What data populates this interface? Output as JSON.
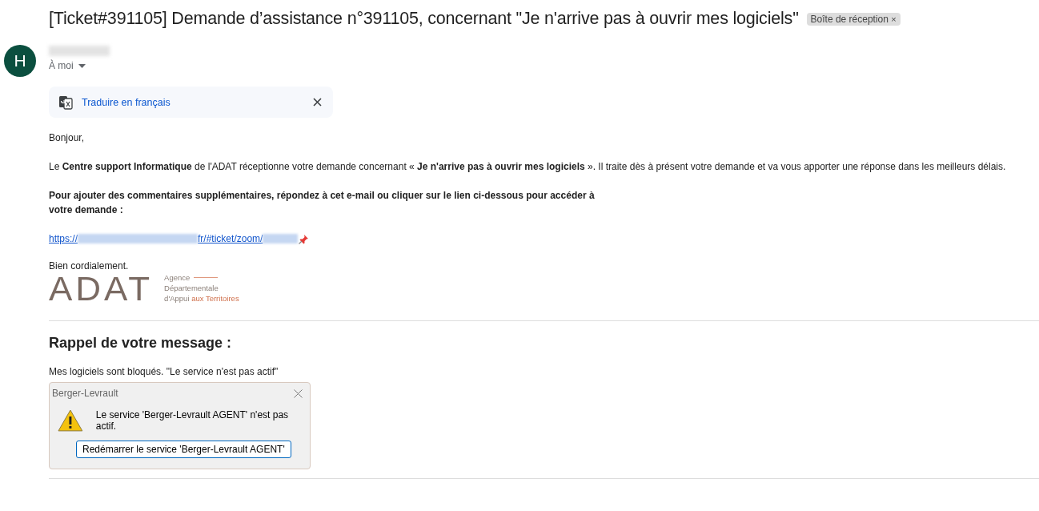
{
  "subject": "[Ticket#391105] Demande d’assistance n°391105, concernant \"Je n'arrive pas à ouvrir mes logiciels\"",
  "label": {
    "text": "Boîte de réception",
    "remove": "×"
  },
  "sender": {
    "avatar": "H",
    "recipient": "À moi"
  },
  "translate": {
    "label": "Traduire en français"
  },
  "body": {
    "greeting": "Bonjour,",
    "paragraph": "Le  **Centre support Informatique** de l'ADAT réceptionne votre demande concernant «  **Je n'arrive pas à ouvrir mes logiciels** ». Il traite dès à présent votre demande et va vous apporter une réponse dans les meilleurs délais.",
    "instruction_lines": [
      "Pour ajouter des commentaires supplémentaires, répondez à cet e-mail ou cliquer sur le lien ci-dessous pour accéder à",
      "votre demande :"
    ],
    "link": {
      "prefix": "https://",
      "middle": "fr/#ticket/zoom/"
    },
    "closing": "Bien cordialement.",
    "logo": {
      "mark": "ADAT",
      "lines": [
        "Agence",
        "Départementale"
      ],
      "line3": "d'Appui",
      "line3_accent": "aux Territoires"
    }
  },
  "reminder": {
    "heading": "Rappel de votre message :",
    "message": "Mes logiciels sont bloqués. \"Le service n'est pas actif\"",
    "dialog": {
      "title": "Berger-Levrault",
      "text": "Le service 'Berger-Levrault AGENT' n'est pas actif.",
      "button": "Redémarrer le service 'Berger-Levrault AGENT'"
    }
  }
}
